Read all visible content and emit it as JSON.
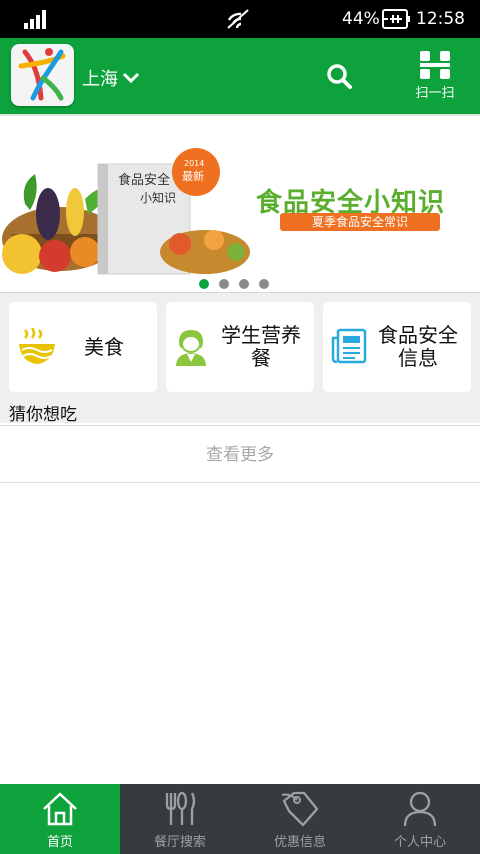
{
  "status_bar": {
    "battery_percent": "44%",
    "time": "12:58",
    "icons": [
      "signal-icon",
      "wifi-icon",
      "battery-charging-icon"
    ]
  },
  "header": {
    "city": "上海",
    "scan_label": "扫一扫",
    "icons": [
      "app-logo",
      "chevron-down-icon",
      "search-icon",
      "scan-icon"
    ]
  },
  "banner": {
    "title": "食品安全小知识",
    "subtitle": "夏季食品安全常识",
    "book_text": "食品安全小知识",
    "badge_year": "2014",
    "badge_text": "最新",
    "slide_count": 4,
    "active_slide": 1
  },
  "categories": [
    {
      "label": "美食",
      "icon": "noodles-icon"
    },
    {
      "label": "学生营养餐",
      "icon": "student-icon"
    },
    {
      "label": "食品安全信息",
      "icon": "news-icon"
    }
  ],
  "guess_title": "猜你想吃",
  "view_more": "查看更多",
  "bottom_nav": [
    {
      "label": "首页",
      "icon": "home-icon",
      "active": true
    },
    {
      "label": "餐厅搜索",
      "icon": "cutlery-icon",
      "active": false
    },
    {
      "label": "优惠信息",
      "icon": "tag-icon",
      "active": false
    },
    {
      "label": "个人中心",
      "icon": "user-icon",
      "active": false
    }
  ],
  "colors": {
    "brand_green": "#0da23b",
    "nav_dark": "#363b3e",
    "banner_orange": "#f07021",
    "icon_yellow": "#e8c400",
    "icon_green": "#8cc63f",
    "icon_blue": "#29a9e0"
  }
}
